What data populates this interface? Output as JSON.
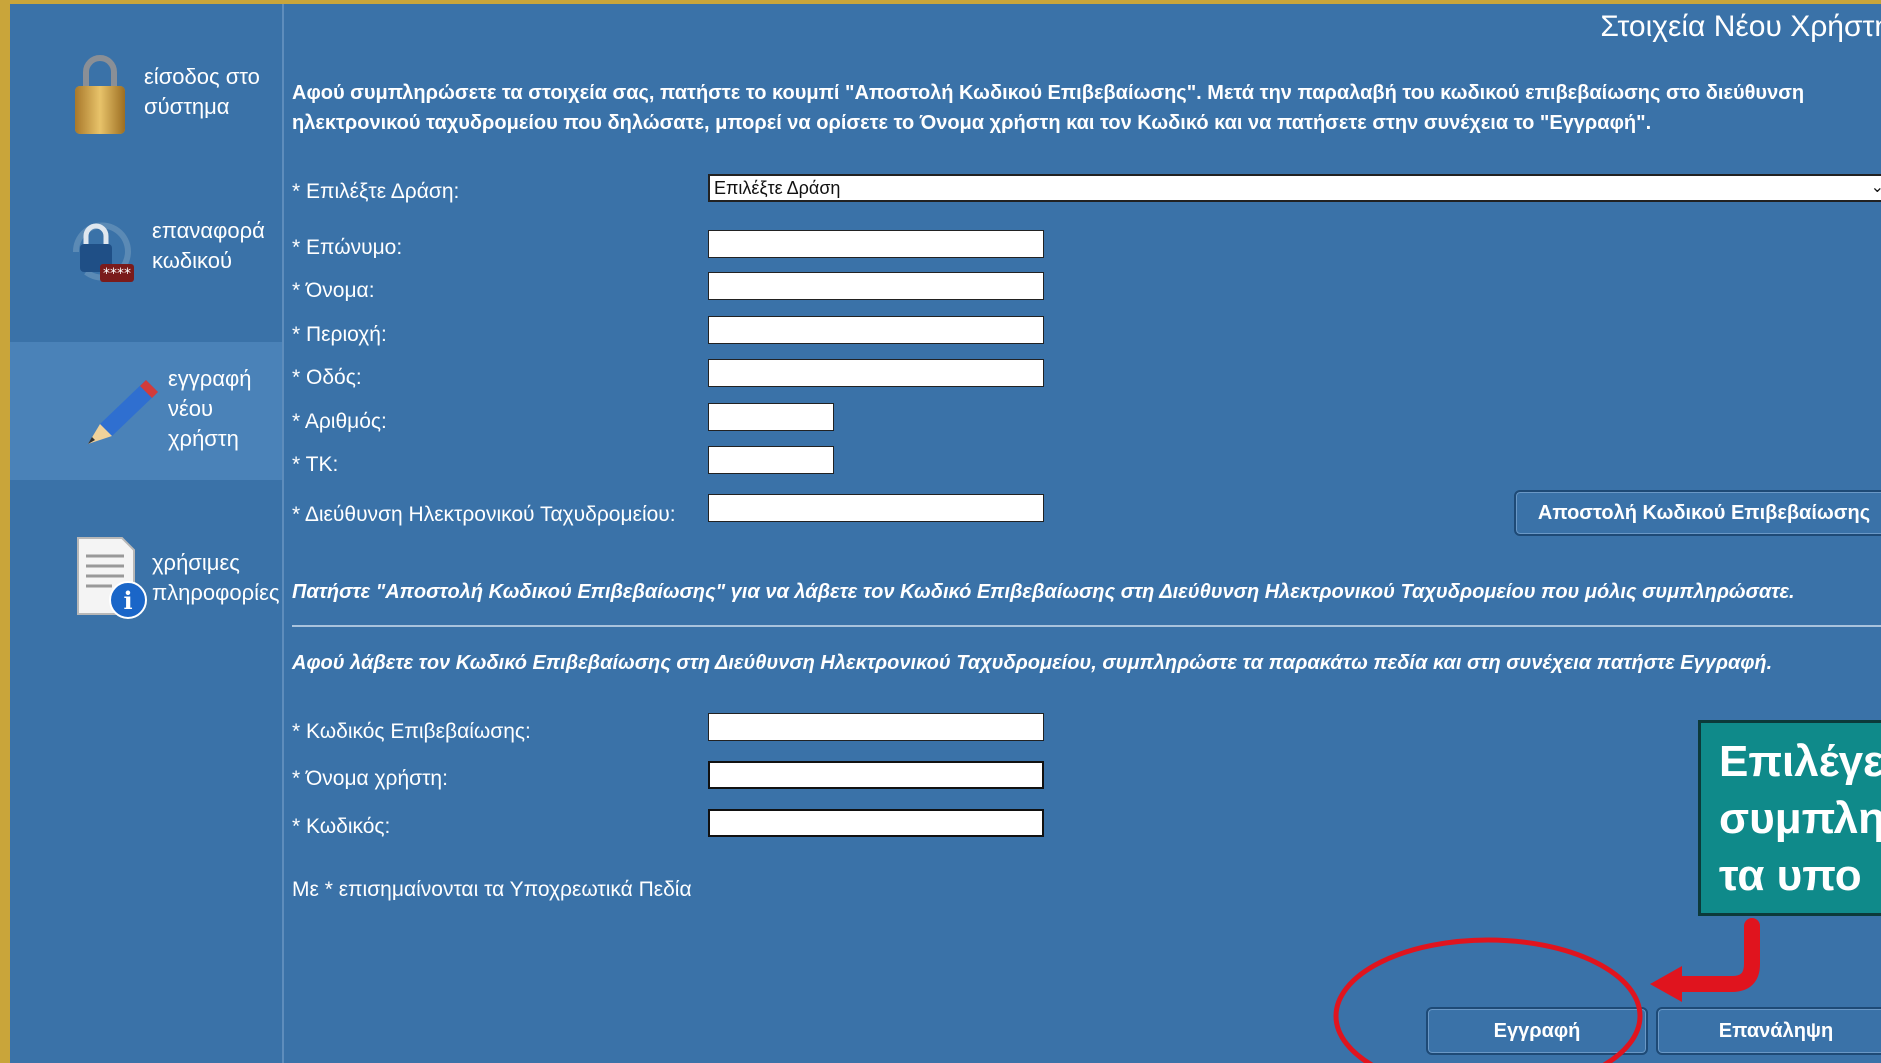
{
  "sidebar": {
    "items": [
      {
        "icon": "padlock-icon",
        "line1": "είσοδος στο",
        "line2": "σύστημα",
        "line3": ""
      },
      {
        "icon": "password-reset-icon",
        "line1": "επαναφορά",
        "line2": "κωδικού",
        "line3": ""
      },
      {
        "icon": "pencil-icon",
        "line1": "εγγραφή",
        "line2": "νέου",
        "line3": "χρήστη"
      },
      {
        "icon": "info-document-icon",
        "line1": "χρήσιμες",
        "line2": "πληροφορίες",
        "line3": ""
      }
    ],
    "active_index": 2
  },
  "header": {
    "title": "Στοιχεία Νέου Χρήστη"
  },
  "intro": "Αφού συμπληρώσετε τα στοιχεία σας, πατήστε το κουμπί \"Αποστολή Κωδικού Επιβεβαίωσης\". Μετά την παραλαβή του κωδικού επιβεβαίωσης στο διεύθυνση ηλεκτρονικού ταχυδρομείου που δηλώσατε, μπορεί να ορίσετε το Όνομα χρήστη και τον Κωδικό και να πατήσετε στην συνέχεια το \"Εγγραφή\".",
  "form": {
    "action_label": "* Επιλέξτε Δράση:",
    "action_value": "Επιλέξτε Δράση",
    "surname_label": "* Επώνυμο:",
    "name_label": "* Όνομα:",
    "region_label": "* Περιοχή:",
    "street_label": "* Οδός:",
    "number_label": "* Αριθμός:",
    "postcode_label": "* ΤΚ:",
    "email_label": "* Διεύθυνση Ηλεκτρονικού Ταχυδρομείου:",
    "send_code_button": "Αποστολή Κωδικού Επιβεβαίωσης",
    "send_note": "Πατήστε \"Αποστολή Κωδικού Επιβεβαίωσης\" για να λάβετε τον Κωδικό Επιβεβαίωσης στη Διεύθυνση Ηλεκτρονικού Ταχυδρομείου που μόλις συμπληρώσατε.",
    "after_note": "Αφού λάβετε τον Κωδικό Επιβεβαίωσης στη Διεύθυνση Ηλεκτρονικού Ταχυδρομείου, συμπληρώστε τα παρακάτω πεδία και στη συνέχεια πατήστε Εγγραφή.",
    "confirm_code_label": "* Κωδικός Επιβεβαίωσης:",
    "username_label": "* Όνομα χρήστη:",
    "password_label": "* Κωδικός:",
    "required_note": "Με * επισημαίνονται τα Υποχρεωτικά Πεδία",
    "register_button": "Εγγραφή",
    "reset_button": "Επανάληψη"
  },
  "callout": {
    "line1": "Επιλέγε",
    "line2": "συμπλη",
    "line3": "τα υπο"
  },
  "colors": {
    "background": "#3a72a8",
    "frame_border": "#c9a53a",
    "callout": "#0f8a8a",
    "annotation": "#e0141e"
  }
}
